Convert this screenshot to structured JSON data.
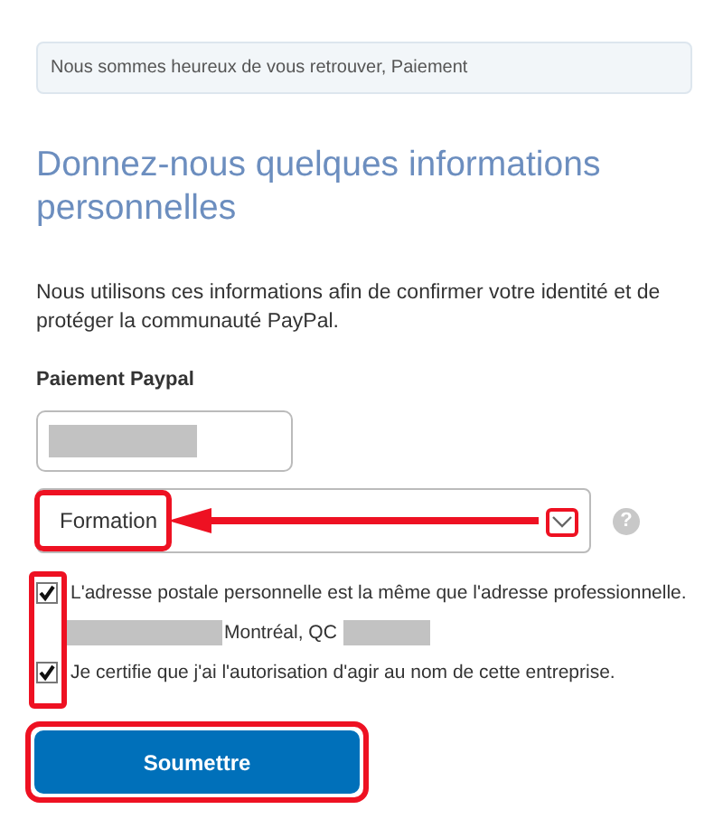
{
  "notice": "Nous sommes heureux de vous retrouver, Paiement",
  "heading": "Donnez-nous quelques informations personnelles",
  "intro": "Nous utilisons ces informations afin de confirmer votre identité et de protéger la communauté PayPal.",
  "field_label": "Paiement Paypal",
  "select": {
    "value": "Formation",
    "help": "?"
  },
  "checkboxes": [
    {
      "label": "L'adresse postale personnelle est la même que l'adresse professionnelle.",
      "checked": true,
      "address": "Montréal, QC"
    },
    {
      "label": "Je certifie que j'ai l'autorisation d'agir au nom de cette entreprise.",
      "checked": true
    }
  ],
  "submit": "Soumettre"
}
